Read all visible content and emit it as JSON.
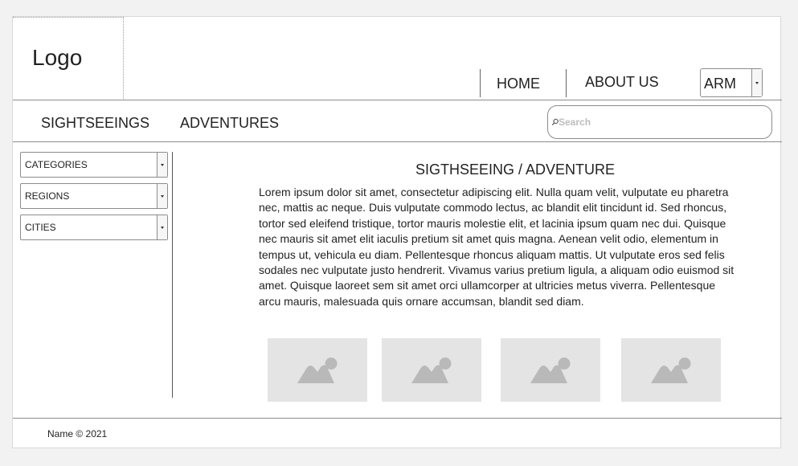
{
  "header": {
    "logo": "Logo",
    "nav": {
      "home": "HOME",
      "about": "ABOUT US"
    },
    "language": {
      "selected": "ARM"
    }
  },
  "subnav": {
    "items": [
      "SIGHTSEEINGS",
      "ADVENTURES"
    ],
    "search": {
      "placeholder": "Search"
    }
  },
  "sidebar": {
    "filters": [
      "CATEGORIES",
      "REGIONS",
      "CITIES"
    ]
  },
  "main": {
    "title": "SIGTHSEEING / ADVENTURE",
    "body": "Lorem ipsum dolor sit amet, consectetur adipiscing elit. Nulla quam velit, vulputate eu pharetra nec, mattis ac neque. Duis vulputate commodo lectus, ac blandit elit tincidunt id. Sed rhoncus, tortor sed eleifend tristique, tortor mauris molestie elit, et lacinia ipsum quam nec dui. Quisque nec mauris sit amet elit iaculis pretium sit amet quis magna. Aenean velit odio, elementum in tempus ut, vehicula eu diam. Pellentesque rhoncus aliquam mattis. Ut vulputate eros sed felis sodales nec vulputate justo hendrerit. Vivamus varius pretium ligula, a aliquam odio euismod sit amet. Quisque laoreet sem sit amet orci ullamcorper at ultricies metus viverra. Pellentesque arcu mauris, malesuada quis ornare accumsan, blandit sed diam.",
    "images": [
      "image-placeholder-icon",
      "image-placeholder-icon",
      "image-placeholder-icon",
      "image-placeholder-icon"
    ]
  },
  "footer": {
    "text": "Name © 2021"
  }
}
